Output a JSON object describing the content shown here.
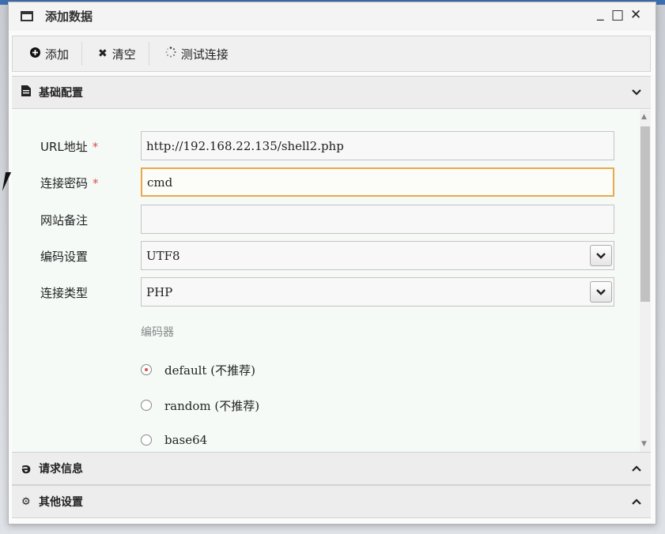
{
  "window": {
    "title": "添加数据",
    "controls": {
      "minimize": "_",
      "maximize": "□",
      "close": "✕"
    }
  },
  "toolbar": {
    "add_label": "添加",
    "clear_label": "清空",
    "test_label": "测试连接"
  },
  "sections": {
    "basic": {
      "label": "基础配置",
      "chevron": "⌄"
    },
    "request": {
      "label": "请求信息",
      "chevron": "⌃"
    },
    "other": {
      "label": "其他设置",
      "chevron": "⌃"
    }
  },
  "form": {
    "url": {
      "label": "URL地址",
      "required": "*",
      "value": "http://192.168.22.135/shell2.php"
    },
    "password": {
      "label": "连接密码",
      "required": "*",
      "value": "cmd"
    },
    "note": {
      "label": "网站备注",
      "value": ""
    },
    "encoding": {
      "label": "编码设置",
      "value": "UTF8"
    },
    "conn_type": {
      "label": "连接类型",
      "value": "PHP"
    }
  },
  "encoder": {
    "label": "编码器",
    "options": [
      {
        "label": "default (不推荐)",
        "checked": true
      },
      {
        "label": "random (不推荐)",
        "checked": false
      },
      {
        "label": "base64",
        "checked": false
      }
    ]
  },
  "icons": {
    "window": "window-icon",
    "add": "plus-circle-icon",
    "clear": "x-icon",
    "test": "spinner-icon",
    "basic": "file-icon",
    "request": "ie-icon",
    "other": "gears-icon"
  },
  "colors": {
    "required": "#d9534f",
    "focus_border": "#e8a94a",
    "content_bg": "#f5faf7"
  }
}
